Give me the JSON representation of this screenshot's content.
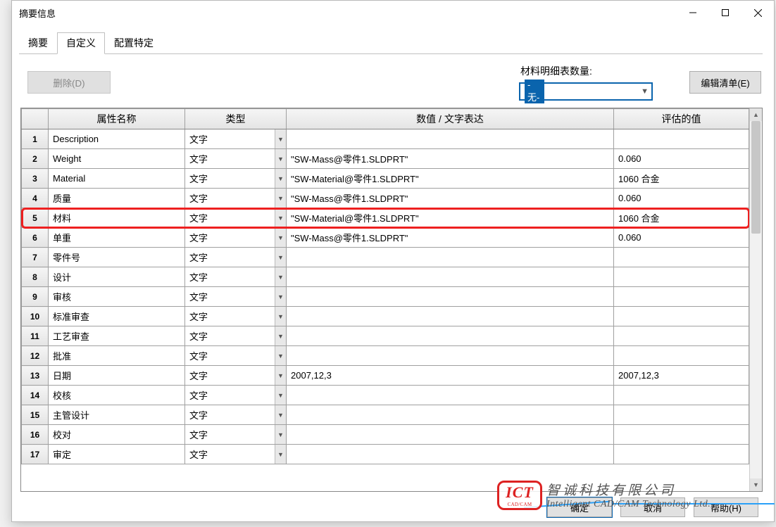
{
  "window": {
    "title": "摘要信息"
  },
  "tabs": [
    "摘要",
    "自定义",
    "配置特定"
  ],
  "active_tab": 1,
  "toolbar": {
    "delete_label": "删除(D)",
    "bom_label": "材料明细表数量:",
    "bom_value": "-无-",
    "edit_list_label": "编辑清单(E)"
  },
  "columns": {
    "rownum": "",
    "prop": "属性名称",
    "type": "类型",
    "value": "数值 / 文字表达",
    "eval": "评估的值"
  },
  "type_text": "文字",
  "rows": [
    {
      "n": "1",
      "prop": "Description",
      "type": "文字",
      "value": "",
      "eval": ""
    },
    {
      "n": "2",
      "prop": "Weight",
      "type": "文字",
      "value": "\"SW-Mass@零件1.SLDPRT\"",
      "eval": "0.060"
    },
    {
      "n": "3",
      "prop": "Material",
      "type": "文字",
      "value": "\"SW-Material@零件1.SLDPRT\"",
      "eval": "1060 合金"
    },
    {
      "n": "4",
      "prop": "质量",
      "type": "文字",
      "value": "\"SW-Mass@零件1.SLDPRT\"",
      "eval": "0.060"
    },
    {
      "n": "5",
      "prop": "材料",
      "type": "文字",
      "value": "\"SW-Material@零件1.SLDPRT\"",
      "eval": "1060 合金"
    },
    {
      "n": "6",
      "prop": "单重",
      "type": "文字",
      "value": "\"SW-Mass@零件1.SLDPRT\"",
      "eval": "0.060"
    },
    {
      "n": "7",
      "prop": "零件号",
      "type": "文字",
      "value": "",
      "eval": ""
    },
    {
      "n": "8",
      "prop": "设计",
      "type": "文字",
      "value": "",
      "eval": ""
    },
    {
      "n": "9",
      "prop": "审核",
      "type": "文字",
      "value": "",
      "eval": ""
    },
    {
      "n": "10",
      "prop": "标准审查",
      "type": "文字",
      "value": "",
      "eval": ""
    },
    {
      "n": "11",
      "prop": "工艺审查",
      "type": "文字",
      "value": "",
      "eval": ""
    },
    {
      "n": "12",
      "prop": "批准",
      "type": "文字",
      "value": "",
      "eval": ""
    },
    {
      "n": "13",
      "prop": "日期",
      "type": "文字",
      "value": "2007,12,3",
      "eval": "2007,12,3"
    },
    {
      "n": "14",
      "prop": "校核",
      "type": "文字",
      "value": "",
      "eval": ""
    },
    {
      "n": "15",
      "prop": "主管设计",
      "type": "文字",
      "value": "",
      "eval": ""
    },
    {
      "n": "16",
      "prop": "校对",
      "type": "文字",
      "value": "",
      "eval": ""
    },
    {
      "n": "17",
      "prop": "审定",
      "type": "文字",
      "value": "",
      "eval": ""
    }
  ],
  "highlight_row_index": 4,
  "footer": {
    "ok": "确定",
    "cancel": "取消",
    "help": "帮助(H)"
  },
  "watermark": {
    "logo_main": "ICT",
    "logo_sub": "CAD/CAM",
    "line1": "智诚科技有限公司",
    "line2": "Intelligent CAD/CAM Technology Ltd."
  }
}
